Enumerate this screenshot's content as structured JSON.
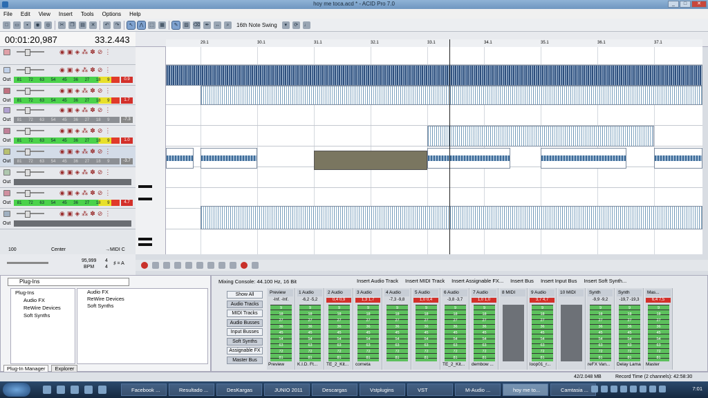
{
  "window": {
    "title": "hoy me toca.acd * - ACID Pro 7.0",
    "min": "_",
    "max": "□",
    "close": "✕"
  },
  "menu": [
    "File",
    "Edit",
    "View",
    "Insert",
    "Tools",
    "Options",
    "Help"
  ],
  "toolbar": {
    "swing_label": "16th Note Swing",
    "icons": [
      "new-icon",
      "open-icon",
      "save-icon",
      "render-icon",
      "properties-icon",
      "cut-icon",
      "copy-icon",
      "paste-icon",
      "delete-icon",
      "undo-icon",
      "redo-icon",
      "pointer-icon",
      "envelope-icon",
      "select-icon",
      "grid-icon",
      "draw-icon",
      "paint-icon",
      "erase-icon",
      "pen-icon",
      "scrub-icon",
      "zoom-icon",
      "snap-icon",
      "loop-icon",
      "metronome-icon"
    ]
  },
  "time": {
    "position": "00:01:20,987",
    "measure": "33.2.443"
  },
  "ruler": {
    "marks": [
      "29.1",
      "30.1",
      "31.1",
      "32.1",
      "33.1",
      "34.1",
      "35.1",
      "36.1",
      "37.1"
    ]
  },
  "tracks": [
    {
      "out": "",
      "meter": [
        "",
        "",
        "",
        "",
        "",
        "",
        "",
        "",
        "",
        ""
      ],
      "val": "",
      "type": "none"
    },
    {
      "out": "Out",
      "meter": [
        "81",
        "72",
        "63",
        "54",
        "45",
        "36",
        "27",
        "18",
        "9",
        ""
      ],
      "val": "0.9",
      "type": "red"
    },
    {
      "out": "Out",
      "meter": [
        "81",
        "72",
        "63",
        "54",
        "45",
        "36",
        "27",
        "18",
        "9",
        ""
      ],
      "val": "1.7",
      "type": "red"
    },
    {
      "out": "Out",
      "meter": [
        "81",
        "72",
        "63",
        "54",
        "45",
        "36",
        "27",
        "18",
        "9",
        ""
      ],
      "val": "-7.3",
      "type": "grey"
    },
    {
      "out": "Out",
      "meter": [
        "81",
        "72",
        "63",
        "54",
        "45",
        "36",
        "27",
        "18",
        "9",
        ""
      ],
      "val": "1.0",
      "type": "red"
    },
    {
      "out": "Out",
      "meter": [
        "81",
        "72",
        "63",
        "54",
        "45",
        "36",
        "27",
        "18",
        "9",
        ""
      ],
      "val": "-3.7",
      "type": "grey"
    },
    {
      "out": "Out",
      "meter": [
        "",
        "",
        "",
        "",
        "",
        "",
        "",
        "",
        "",
        ""
      ],
      "val": "",
      "type": "bar"
    },
    {
      "out": "Out",
      "meter": [
        "81",
        "72",
        "63",
        "54",
        "45",
        "36",
        "27",
        "18",
        "9",
        ""
      ],
      "val": "4.7",
      "type": "red"
    },
    {
      "out": "Out",
      "meter": [
        "",
        "",
        "",
        "",
        "",
        "",
        "",
        "",
        "",
        ""
      ],
      "val": "",
      "type": "bar"
    }
  ],
  "bottomctl": {
    "left": "100",
    "center": "Center",
    "midi": "→MIDI C"
  },
  "tempo": {
    "bpm": "95,999",
    "bpm_label": "BPM",
    "sig_top": "4",
    "sig_bottom": "4",
    "key": "♯ = A"
  },
  "plugins": {
    "header": "Plug-Ins",
    "tree": [
      "Plug-Ins",
      "Audio FX",
      "ReWire Devices",
      "Soft Synths"
    ],
    "list": [
      "Audio FX",
      "ReWire Devices",
      "Soft Synths"
    ],
    "tabs": [
      "Plug-In Manager",
      "Explorer"
    ]
  },
  "mixer": {
    "title": "Mixing Console: 44.100 Hz, 16 Bit",
    "buttons": [
      "Insert Audio Track",
      "Insert MIDI Track",
      "Insert Assignable FX...",
      "Insert Bus",
      "Insert Input Bus",
      "Insert Soft Synth..."
    ],
    "side": [
      "Show All",
      "Audio Tracks",
      "MIDI Tracks",
      "Audio Busses",
      "Input Busses",
      "Soft Synths",
      "Assignable FX",
      "Master Bus"
    ],
    "strips": [
      {
        "type": "Preview",
        "lv": "-Inf.  -Inf.",
        "name": "Preview",
        "red": false
      },
      {
        "type": "1 Audio",
        "lv": "-6,2  -5,2",
        "name": "K.I.D. Ft...",
        "red": false
      },
      {
        "type": "2 Audio",
        "lv": "0,4  0,9",
        "name": "TE_2_Kit...",
        "red": true
      },
      {
        "type": "3 Audio",
        "lv": "1,3  1,7",
        "name": "corneta",
        "red": true
      },
      {
        "type": "4 Audio",
        "lv": "-7,3  -9,8",
        "name": "",
        "red": false
      },
      {
        "type": "5 Audio",
        "lv": "1,0  0,4",
        "name": "",
        "red": true
      },
      {
        "type": "6 Audio",
        "lv": "-3,8  -3,7",
        "name": "TE_2_Kit...",
        "red": false
      },
      {
        "type": "7 Audio",
        "lv": "1,0  1,0",
        "name": "dembow ...",
        "red": true
      },
      {
        "type": "8 MIDI",
        "lv": "",
        "name": "",
        "red": false
      },
      {
        "type": "9 Audio",
        "lv": "3,7  4,7",
        "name": "loop01_r...",
        "red": true
      },
      {
        "type": "10 MIDI",
        "lv": "",
        "name": "",
        "red": false
      },
      {
        "type": "Synth",
        "lv": "-9,9  -9,2",
        "name": "reFX Van...",
        "red": false
      },
      {
        "type": "Synth",
        "lv": "-19,7  -19,3",
        "name": "Delay Lama",
        "red": false
      },
      {
        "type": "Mas...",
        "lv": "6,4  7,5",
        "name": "Master",
        "red": true
      }
    ],
    "meter_labels": [
      "9",
      "18",
      "27",
      "36",
      "45",
      "54",
      "63",
      "72",
      "81"
    ]
  },
  "status": {
    "mem": "42/2.048 MB",
    "rec": "Record Time (2 channels): 42:58:30"
  },
  "taskbar": {
    "tasks": [
      "Facebook ...",
      "Resultado ...",
      "DesKargas",
      "JUNIO 2011",
      "Descargas",
      "Vstplugins",
      "VST",
      "M-Audio ...",
      "hoy me to...",
      "Camtasia ..."
    ],
    "clock": "7:01"
  },
  "colors": {
    "meter_green": "#4bd24b",
    "clip_red": "#d3302a",
    "wave_blue": "#41628e",
    "olive_clip": "#7a7660"
  }
}
